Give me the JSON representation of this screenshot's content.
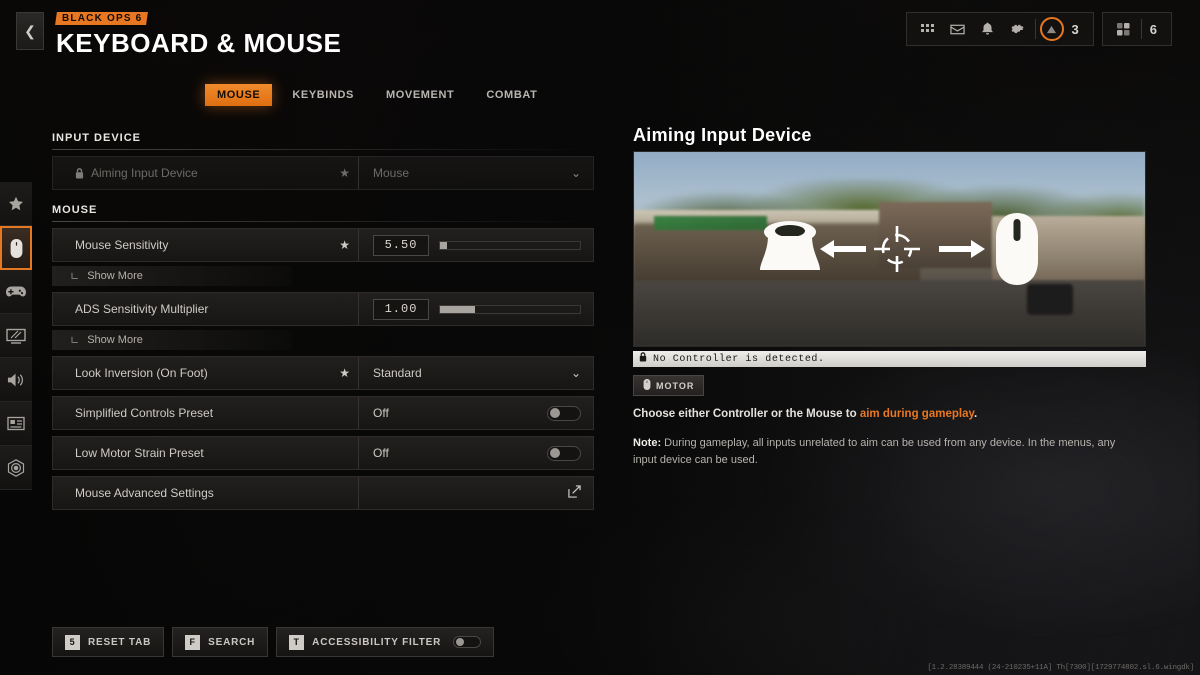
{
  "header": {
    "back_icon": "chevron-left-icon",
    "game_logo": "BLACK OPS 6",
    "title": "KEYBOARD & MOUSE",
    "icons": [
      "grid-icon",
      "mail-icon",
      "bell-icon",
      "gear-icon"
    ],
    "account_badge": {
      "icon": "triangle-icon",
      "count": "3"
    },
    "party_badge": {
      "icon": "players-icon",
      "count": "6"
    }
  },
  "tabs": [
    {
      "label": "MOUSE",
      "active": true
    },
    {
      "label": "KEYBINDS",
      "active": false
    },
    {
      "label": "MOVEMENT",
      "active": false
    },
    {
      "label": "COMBAT",
      "active": false
    }
  ],
  "rail": [
    {
      "name": "sidebar-item-favorites",
      "icon": "star-icon",
      "active": false
    },
    {
      "name": "sidebar-item-mouse",
      "icon": "mouse-icon",
      "active": true
    },
    {
      "name": "sidebar-item-controller",
      "icon": "gamepad-icon",
      "active": false
    },
    {
      "name": "sidebar-item-graphics",
      "icon": "monitor-icon",
      "active": false
    },
    {
      "name": "sidebar-item-audio",
      "icon": "speaker-icon",
      "active": false
    },
    {
      "name": "sidebar-item-interface",
      "icon": "hud-card-icon",
      "active": false
    },
    {
      "name": "sidebar-item-accessibility",
      "icon": "radar-icon",
      "active": false
    }
  ],
  "settings": {
    "section_input_device": "INPUT DEVICE",
    "section_mouse": "MOUSE",
    "aiming_input_device": {
      "label": "Aiming Input Device",
      "value": "Mouse",
      "lock_icon": "lock-icon",
      "star_icon": "star-icon",
      "chevron_icon": "chevron-down-icon"
    },
    "mouse_sensitivity": {
      "label": "Mouse Sensitivity",
      "value": "5.50",
      "slider_percent": 5,
      "star_icon": "star-icon",
      "show_more": "Show More"
    },
    "ads_sensitivity_multiplier": {
      "label": "ADS Sensitivity Multiplier",
      "value": "1.00",
      "slider_percent": 25,
      "show_more": "Show More"
    },
    "look_inversion": {
      "label": "Look Inversion (On Foot)",
      "value": "Standard",
      "star_icon": "star-icon",
      "chevron_icon": "chevron-down-icon"
    },
    "simplified_controls_preset": {
      "label": "Simplified Controls Preset",
      "value": "Off",
      "toggle_on": false
    },
    "low_motor_strain_preset": {
      "label": "Low Motor Strain Preset",
      "value": "Off",
      "toggle_on": false
    },
    "mouse_advanced_settings": {
      "label": "Mouse Advanced Settings",
      "ext_icon": "external-link-icon"
    }
  },
  "preview": {
    "title": "Aiming Input Device",
    "image_overlay": {
      "stick_icon": "analog-stick-icon",
      "left_arrow_icon": "arrow-left-icon",
      "crosshair_icon": "crosshair-icon",
      "right_arrow_icon": "arrow-right-icon",
      "mouse_icon": "mouse-icon"
    },
    "banner": {
      "lock_icon": "lock-icon",
      "text": "No Controller is detected."
    },
    "badge": {
      "icon": "mouse-icon",
      "label": "MOTOR"
    },
    "description_prefix": "Choose either Controller or the Mouse to ",
    "description_accent": "aim during gameplay",
    "description_suffix": ".",
    "note_label": "Note:",
    "note_text": " During gameplay, all inputs unrelated to aim can be used from any device. In the menus, any input device can be used."
  },
  "bottom_bar": [
    {
      "key": "5",
      "label": "RESET TAB"
    },
    {
      "key": "F",
      "label": "SEARCH"
    },
    {
      "key": "T",
      "label": "ACCESSIBILITY FILTER",
      "toggle": true
    }
  ],
  "build_string": "[1.2.28389444 (24-210235+11A] Th[7300][1729774802.sl.6.wingdk]",
  "colors": {
    "accent": "#e87722",
    "panel": "#242220",
    "text": "#cfcbc6"
  }
}
